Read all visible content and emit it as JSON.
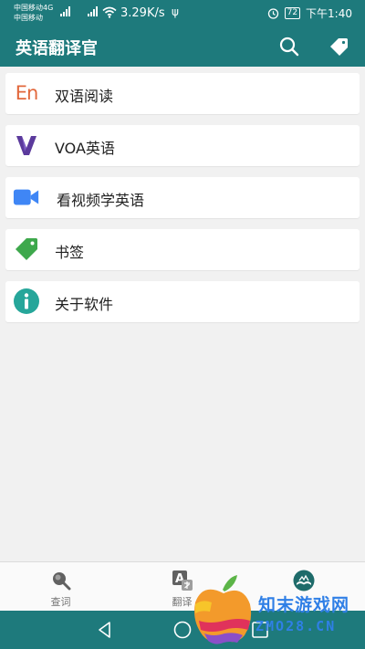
{
  "status_bar": {
    "carrier_1": "中国移动4G",
    "carrier_2": "中国移动",
    "net_speed": "3.29K/s",
    "battery": "72",
    "time": "下午1:40",
    "icons": [
      "signal-icon",
      "wifi-icon",
      "usb-icon",
      "alarm-icon",
      "battery-icon"
    ]
  },
  "app_bar": {
    "title": "英语翻译官",
    "actions": [
      "search-icon",
      "tag-icon"
    ]
  },
  "menu": {
    "items": [
      {
        "label": "双语阅读",
        "icon": "en-text-icon",
        "icon_text": "En",
        "color": "#e2683c"
      },
      {
        "label": "VOA英语",
        "icon": "voa-v-icon",
        "color": "#5b3a9c"
      },
      {
        "label": "看视频学英语",
        "icon": "video-camera-icon",
        "color": "#3f86f5"
      },
      {
        "label": "书签",
        "icon": "bookmark-tag-icon",
        "color": "#3ea84c"
      },
      {
        "label": "关于软件",
        "icon": "info-icon",
        "color": "#26a69a"
      }
    ]
  },
  "bottom_nav": {
    "items": [
      {
        "label": "查词",
        "icon": "search-icon"
      },
      {
        "label": "翻译",
        "icon": "translate-icon"
      },
      {
        "label": "",
        "icon": "book-icon"
      }
    ],
    "active_color": "#1e6b6a"
  },
  "watermark": {
    "line_1": "知末游戏网",
    "line_2": "ZMO28.CN"
  },
  "theme": {
    "primary": "#1e7a7c",
    "background": "#f1f1f1"
  }
}
